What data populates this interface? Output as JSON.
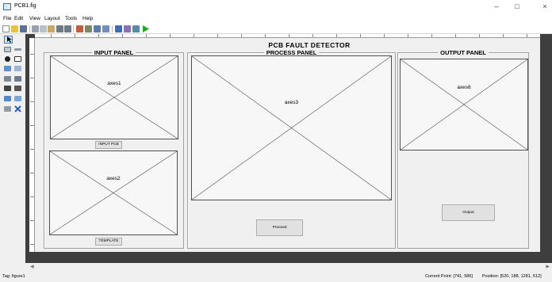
{
  "window": {
    "title": "PCB1.fig",
    "controls": {
      "minimize": "–",
      "maximize": "□",
      "close": "×"
    }
  },
  "menu": [
    "File",
    "Edit",
    "View",
    "Layout",
    "Tools",
    "Help"
  ],
  "toolbar_icons": [
    "new-icon",
    "open-icon",
    "save-icon",
    "cut-icon",
    "copy-icon",
    "paste-icon",
    "undo-icon",
    "redo-icon",
    "align-icon",
    "menu-editor-icon",
    "tab-order-icon",
    "toolbar-editor-icon",
    "editor-icon",
    "property-inspector-icon",
    "object-browser-icon",
    "run-icon"
  ],
  "palette_icons": [
    "select-tool-icon",
    "pushbutton-tool-icon",
    "slider-tool-icon",
    "radio-button-tool-icon",
    "checkbox-tool-icon",
    "edit-text-tool-icon",
    "static-text-tool-icon",
    "popup-menu-tool-icon",
    "listbox-tool-icon",
    "toggle-button-tool-icon",
    "table-tool-icon",
    "axes-tool-icon",
    "panel-tool-icon",
    "button-group-tool-icon",
    "activex-tool-icon"
  ],
  "colors": {
    "run_icon": "#1fa91f",
    "canvas_background": "#3e3e3e",
    "figure_background": "#f0f0f0"
  },
  "figure": {
    "title": "PCB  FAULT  DETECTOR",
    "panels": {
      "input": {
        "title": "INPUT PANEL",
        "axes1": "axes1",
        "axes2": "axes2",
        "input_button": "INPUT PCB",
        "template_button": "TEMPLATE"
      },
      "process": {
        "title": "PROCESS PANEL",
        "axes3": "axes3",
        "proceed_button": "Proceed"
      },
      "output": {
        "title": "OUTPUT PANEL",
        "axes6": "axes6",
        "output_button": "Output"
      }
    }
  },
  "status": {
    "tag": "Tag: figure1",
    "current_point": "Current Point:  [741, 586]",
    "position": "Position: [520, 188, 1281, 612]"
  }
}
